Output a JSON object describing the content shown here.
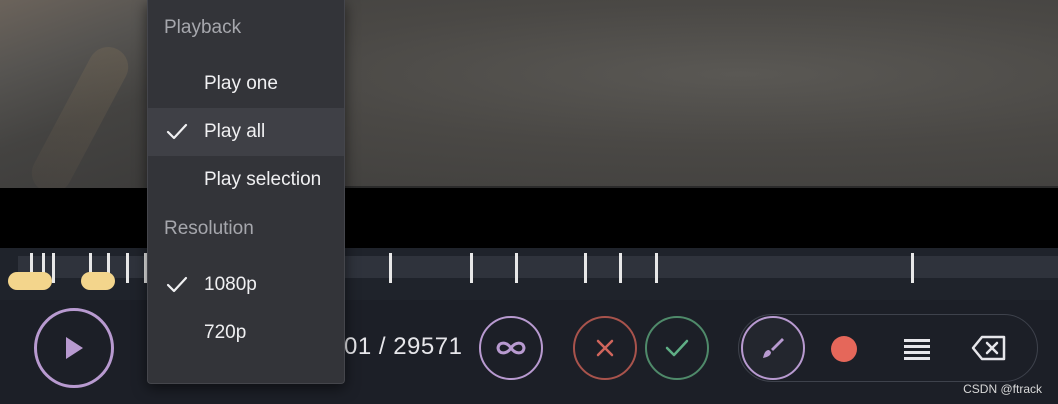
{
  "menu": {
    "sections": [
      {
        "header": "Playback",
        "items": [
          {
            "label": "Play one",
            "checked": false
          },
          {
            "label": "Play all",
            "checked": true
          },
          {
            "label": "Play selection",
            "checked": false
          }
        ]
      },
      {
        "header": "Resolution",
        "items": [
          {
            "label": "1080p",
            "checked": true
          },
          {
            "label": "720p",
            "checked": false
          }
        ]
      }
    ]
  },
  "player": {
    "frame_counter": "01 / 29571"
  },
  "icons": {
    "play": "play-icon",
    "loop": "infinity-icon",
    "reject": "close-icon",
    "accept": "check-icon",
    "brush": "brush-icon",
    "record": "record-dot-icon",
    "list": "list-icon",
    "backspace": "backspace-icon"
  },
  "colors": {
    "accent_purple": "#b89ad0",
    "reject_red": "#a8534c",
    "accept_green": "#4f8a6a",
    "record_red": "#e5675a",
    "range_marker": "#f3d58c"
  },
  "watermark": "CSDN @ftrack"
}
